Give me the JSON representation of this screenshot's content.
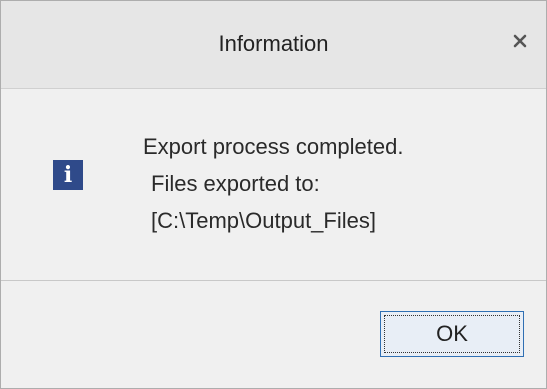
{
  "dialog": {
    "title": "Information",
    "icon": "info-icon",
    "message": {
      "line1": "Export process completed.",
      "line2": "Files exported to:",
      "line3": "[C:\\Temp\\Output_Files]"
    },
    "ok_label": "OK"
  },
  "colors": {
    "icon_bg": "#2f4a8a",
    "titlebar": "#e6e6e6",
    "button_border": "#2f6fb3"
  }
}
